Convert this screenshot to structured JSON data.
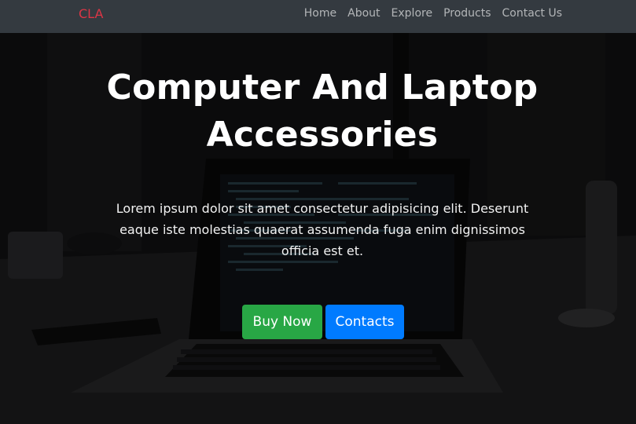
{
  "navbar": {
    "brand": "CLA",
    "links": [
      "Home",
      "About",
      "Explore",
      "Products",
      "Contact Us"
    ]
  },
  "hero": {
    "title": "Computer And Laptop Accessories",
    "text": "Lorem ipsum dolor sit amet consectetur adipisicing elit. Deserunt eaque iste molestias quaerat assumenda fuga enim dignissimos officia est et.",
    "buttons": {
      "buy": "Buy Now",
      "contacts": "Contacts"
    }
  },
  "colors": {
    "navbar_bg": "#343a40",
    "brand": "#dc3545",
    "buy_button": "#28a745",
    "contacts_button": "#007bff"
  }
}
